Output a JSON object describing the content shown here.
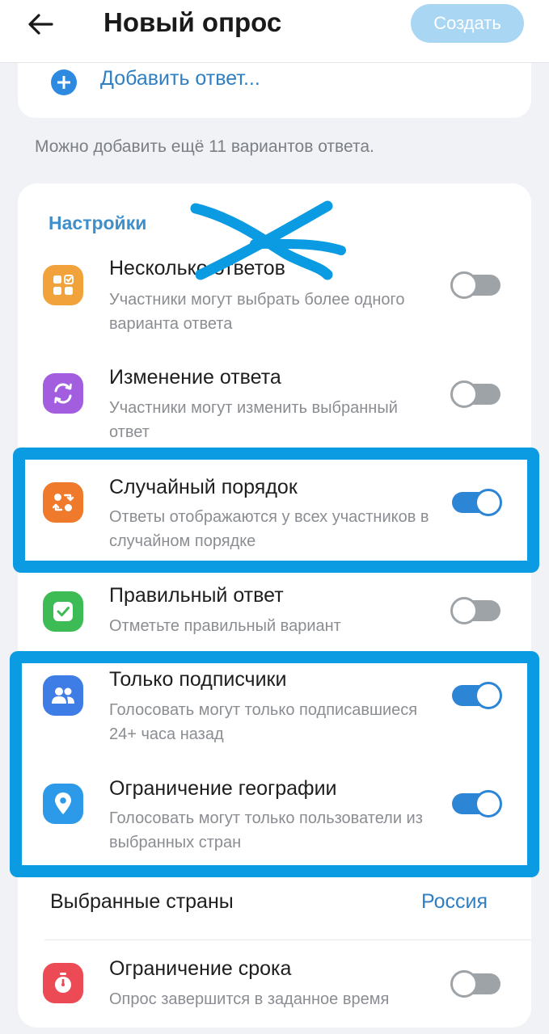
{
  "header": {
    "title": "Новый опрос",
    "create_label": "Создать",
    "back_icon": "arrow-left-icon"
  },
  "add_answer": {
    "label": "Добавить ответ...",
    "icon": "plus-circle-icon"
  },
  "hint": "Можно добавить ещё 11 вариантов ответа.",
  "settings": {
    "title": "Настройки",
    "items": [
      {
        "title": "Несколько ответов",
        "desc": "Участники могут выбрать более одного варианта ответа",
        "icon": "multiple-choice-icon",
        "icon_color": "#f2a23a",
        "enabled": false
      },
      {
        "title": "Изменение ответа",
        "desc": "Участники могут изменить выбранный ответ",
        "icon": "refresh-icon",
        "icon_color": "#a35ee0",
        "enabled": false
      },
      {
        "title": "Случайный порядок",
        "desc": "Ответы отображаются у всех участников в случайном порядке",
        "icon": "shuffle-icon",
        "icon_color": "#ef7a2c",
        "enabled": true
      },
      {
        "title": "Правильный ответ",
        "desc": "Отметьте правильный вариант",
        "icon": "check-icon",
        "icon_color": "#3dbb55",
        "enabled": false
      },
      {
        "title": "Только подписчики",
        "desc": "Голосовать могут только подписавшиеся 24+ часа назад",
        "icon": "users-icon",
        "icon_color": "#3f7de6",
        "enabled": true
      },
      {
        "title": "Ограничение географии",
        "desc": "Голосовать могут только пользователи из выбранных стран",
        "icon": "location-pin-icon",
        "icon_color": "#2c9ae8",
        "enabled": true
      }
    ],
    "countries": {
      "label": "Выбранные страны",
      "value": "Россия"
    },
    "time_limit": {
      "title": "Ограничение срока",
      "desc": "Опрос завершится в заданное время",
      "icon": "timer-icon",
      "icon_color": "#ec4a55",
      "enabled": false
    }
  },
  "highlight_color": "#0a9be3"
}
